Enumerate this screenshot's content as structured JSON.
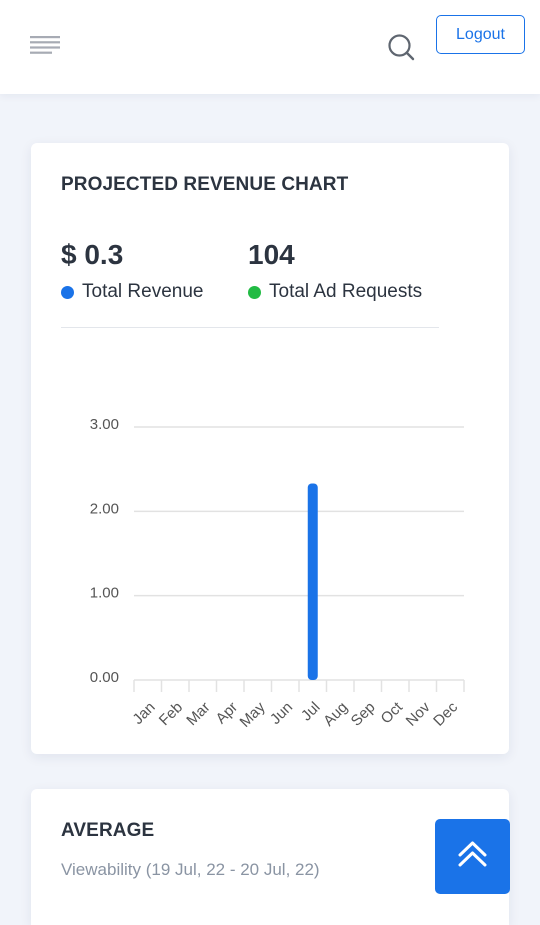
{
  "header": {
    "menu_icon": "hamburger-menu-icon",
    "search_icon": "search-icon",
    "logout_label": "Logout",
    "accent": "#1a73e8"
  },
  "revenue_card": {
    "title": "PROJECTED REVENUE CHART",
    "revenue": {
      "value": "$ 0.3",
      "label": "Total Revenue",
      "color": "#1a73e8"
    },
    "ad_requests": {
      "value": "104",
      "label": "Total Ad Requests",
      "color": "#22bb44"
    }
  },
  "chart_data": {
    "type": "bar",
    "categories": [
      "Jan",
      "Feb",
      "Mar",
      "Apr",
      "May",
      "Jun",
      "Jul",
      "Aug",
      "Sep",
      "Oct",
      "Nov",
      "Dec"
    ],
    "series": [
      {
        "values": [
          0,
          0,
          0,
          0,
          0,
          0,
          2.33,
          0,
          0,
          0,
          0,
          0
        ],
        "color": "#1a73e8"
      }
    ],
    "yticks": [
      "3.00",
      "2.00",
      "1.00",
      "0.00"
    ],
    "ylim": [
      0,
      3
    ],
    "grid": true,
    "title": "",
    "xlabel": "",
    "ylabel": ""
  },
  "average_card": {
    "title": "AVERAGE",
    "subtitle": "Viewability (19 Jul, 22 - 20 Jul, 22)"
  },
  "scroll_top_icon": "double-chevron-up-icon"
}
